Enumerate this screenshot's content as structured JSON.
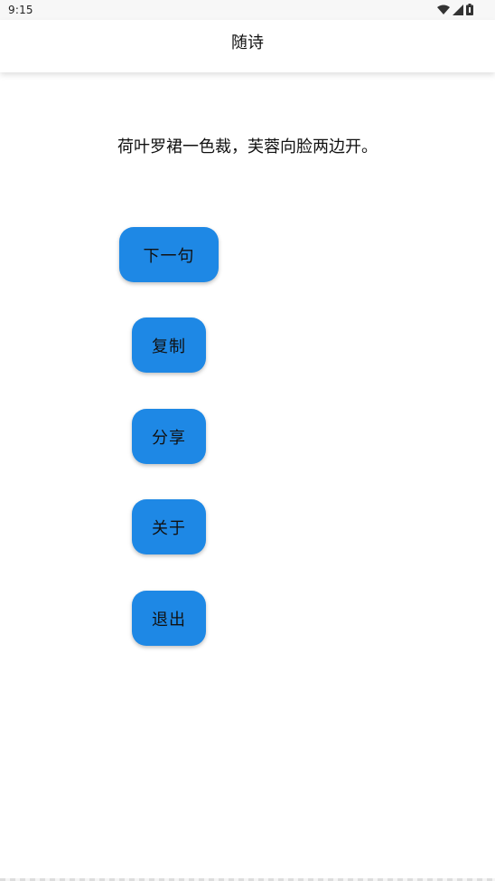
{
  "status_bar": {
    "time": "9:15",
    "icons": [
      "wifi-icon",
      "signal-icon",
      "battery-icon"
    ]
  },
  "app_bar": {
    "title": "随诗"
  },
  "poem": {
    "line": "荷叶罗裙一色裁，芙蓉向脸两边开。"
  },
  "buttons": {
    "next": "下一句",
    "copy": "复制",
    "share": "分享",
    "about": "关于",
    "exit": "退出"
  },
  "colors": {
    "accent": "#1e88e5",
    "background": "#ffffff",
    "status_bar": "#f7f7f7"
  }
}
